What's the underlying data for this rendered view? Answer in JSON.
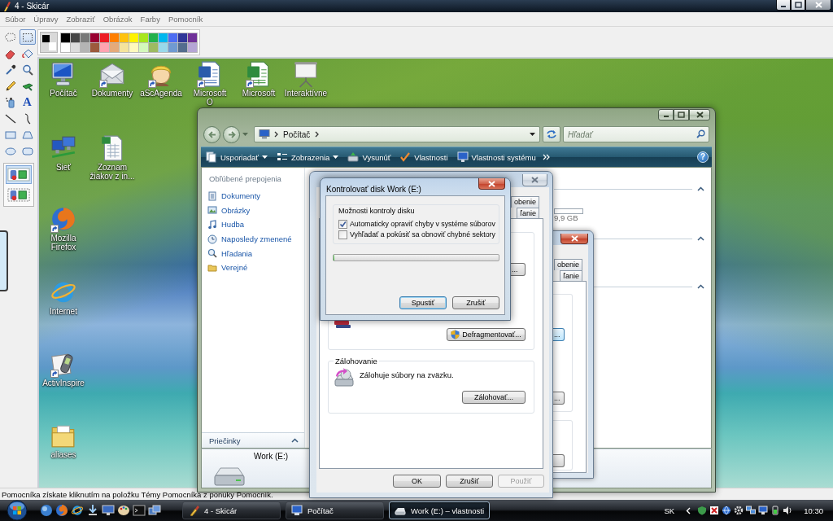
{
  "window": {
    "title": "4 - Skicár"
  },
  "menu": [
    {
      "label": "Súbor"
    },
    {
      "label": "Úpravy"
    },
    {
      "label": "Zobraziť"
    },
    {
      "label": "Obrázok"
    },
    {
      "label": "Farby"
    },
    {
      "label": "Pomocník"
    }
  ],
  "tools": [
    {
      "kind": "free-select",
      "selected": false
    },
    {
      "kind": "select",
      "selected": true
    },
    {
      "kind": "eraser",
      "selected": false
    },
    {
      "kind": "fill",
      "selected": false
    },
    {
      "kind": "color-picker",
      "selected": false
    },
    {
      "kind": "magnifier",
      "selected": false
    },
    {
      "kind": "pencil",
      "selected": false
    },
    {
      "kind": "brush",
      "selected": false
    },
    {
      "kind": "airbrush",
      "selected": false
    },
    {
      "kind": "text",
      "glyph": "A",
      "selected": false
    },
    {
      "kind": "line",
      "selected": false
    },
    {
      "kind": "curve",
      "selected": false
    },
    {
      "kind": "rectangle",
      "selected": false
    },
    {
      "kind": "polygon",
      "selected": false
    },
    {
      "kind": "ellipse",
      "selected": false
    },
    {
      "kind": "rounded-rectangle",
      "selected": false
    }
  ],
  "selection_modes": [
    {
      "kind": "opaque",
      "selected": true
    },
    {
      "kind": "transparent",
      "selected": false
    }
  ],
  "current_colors": [
    {
      "kind": "foreground",
      "color": "#000000"
    },
    {
      "kind": "background",
      "color": "#ffffff"
    }
  ],
  "palette": [
    {
      "color": "#000000"
    },
    {
      "color": "#464646"
    },
    {
      "color": "#787878"
    },
    {
      "color": "#990030"
    },
    {
      "color": "#ed1c24"
    },
    {
      "color": "#ff7e00"
    },
    {
      "color": "#ffc20e"
    },
    {
      "color": "#fff200"
    },
    {
      "color": "#a8e61d"
    },
    {
      "color": "#22b14c"
    },
    {
      "color": "#00b7ef"
    },
    {
      "color": "#4d6df3"
    },
    {
      "color": "#2f3699"
    },
    {
      "color": "#6f3198"
    },
    {
      "color": "#ffffff"
    },
    {
      "color": "#dcdcdc"
    },
    {
      "color": "#b4b4b4"
    },
    {
      "color": "#9c5a3c"
    },
    {
      "color": "#ffa3b1"
    },
    {
      "color": "#e5aa7a"
    },
    {
      "color": "#f5e49c"
    },
    {
      "color": "#fff9bd"
    },
    {
      "color": "#d3f9bc"
    },
    {
      "color": "#9dbb61"
    },
    {
      "color": "#99d9ea"
    },
    {
      "color": "#709ad1"
    },
    {
      "color": "#546d8e"
    },
    {
      "color": "#b5a5d5"
    }
  ],
  "desktop_icons": [
    {
      "lines": [
        "Počítač"
      ],
      "kind": "computer",
      "shortcut": false
    },
    {
      "lines": [
        "Dokumenty"
      ],
      "kind": "envelope",
      "shortcut": true
    },
    {
      "lines": [
        "aScAgenda"
      ],
      "kind": "avatar",
      "shortcut": true
    },
    {
      "lines": [
        "Microsoft",
        "O"
      ],
      "kind": "word",
      "shortcut": true
    },
    {
      "lines": [
        "Microsoft"
      ],
      "kind": "excel",
      "shortcut": true
    },
    {
      "lines": [
        "Interaktívne"
      ],
      "kind": "projector",
      "shortcut": false
    },
    {
      "lines": [
        "Sieť"
      ],
      "kind": "network",
      "shortcut": false
    },
    {
      "lines": [
        "Zoznam",
        "žiakov z in..."
      ],
      "kind": "spreadsheet",
      "shortcut": false
    },
    {
      "lines": [
        "Mozilla",
        "Firefox"
      ],
      "kind": "firefox",
      "shortcut": true
    },
    {
      "lines": [
        "Internet"
      ],
      "kind": "ie",
      "shortcut": false
    },
    {
      "lines": [
        "ActivInspire"
      ],
      "kind": "activinspire",
      "shortcut": true
    },
    {
      "lines": [
        "aliases"
      ],
      "kind": "folder",
      "shortcut": false
    }
  ],
  "explorer": {
    "address": "Počítač",
    "search_placeholder": "Hľadať",
    "commands": [
      {
        "label": "Usporiadať",
        "kind": "organize",
        "dropdown": true
      },
      {
        "label": "Zobrazenia",
        "kind": "views",
        "dropdown": true
      },
      {
        "label": "Vysunúť",
        "kind": "eject",
        "dropdown": false
      },
      {
        "label": "Vlastnosti",
        "kind": "properties",
        "dropdown": false
      },
      {
        "label": "Vlastnosti systému",
        "kind": "system",
        "dropdown": false
      }
    ],
    "help": "?",
    "favorites_title": "Obľúbené prepojenia",
    "favorites": [
      {
        "label": "Dokumenty",
        "kind": "documents"
      },
      {
        "label": "Obrázky",
        "kind": "pictures"
      },
      {
        "label": "Hudba",
        "kind": "music"
      },
      {
        "label": "Naposledy zmenené",
        "kind": "recent"
      },
      {
        "label": "Hľadania",
        "kind": "searches"
      },
      {
        "label": "Verejné",
        "kind": "public"
      }
    ],
    "folders_title": "Priečinky",
    "drive_free": "9,9 GB",
    "details_name": "Work (E:)"
  },
  "ghost_window": {
    "tabs": [
      {
        "label": "obenie",
        "selected": false
      },
      {
        "label": "ľanie",
        "selected": false
      }
    ],
    "buttons": [
      {
        "label": "...",
        "highlighted": true
      },
      {
        "label": "...",
        "highlighted": false
      },
      {
        "highlighted": false
      }
    ]
  },
  "properties": {
    "tabs": [
      {
        "label": "obenie",
        "selected": false
      },
      {
        "label": "ľanie",
        "selected": false
      }
    ],
    "check_button": "...",
    "defrag_button": "Defragmentovať...",
    "backup": {
      "title": "Zálohovanie",
      "text": "Zálohuje súbory na zväzku.",
      "button": "Zálohovať..."
    },
    "buttons": [
      {
        "label": "OK",
        "disabled": false
      },
      {
        "label": "Zrušiť",
        "disabled": false
      },
      {
        "label": "Použiť",
        "disabled": true
      }
    ]
  },
  "check_disk": {
    "title": "Kontrolovať disk Work (E:)",
    "group_title": "Možnosti kontroly disku",
    "options": [
      {
        "label": "Automaticky opraviť chyby v systéme súborov",
        "checked": true
      },
      {
        "label": "Vyhľadať a pokúsiť sa obnoviť chybné sektory",
        "checked": false
      }
    ],
    "progress": {
      "level": 0
    },
    "buttons": [
      {
        "label": "Spustiť",
        "default": true
      },
      {
        "label": "Zrušiť",
        "default": false
      }
    ]
  },
  "status_bar": "Pomocníka získate kliknutím na položku Témy Pomocníka z ponuky Pomocník.",
  "taskbar": {
    "tasks": [
      {
        "label": "4 - Skicár",
        "kind": "paint",
        "selected": false
      },
      {
        "label": "Počítač",
        "kind": "computer",
        "selected": false
      },
      {
        "label": "Work (E:) – vlastnosti",
        "kind": "drive",
        "selected": true
      }
    ],
    "language": "SK",
    "clock": "10:30"
  }
}
